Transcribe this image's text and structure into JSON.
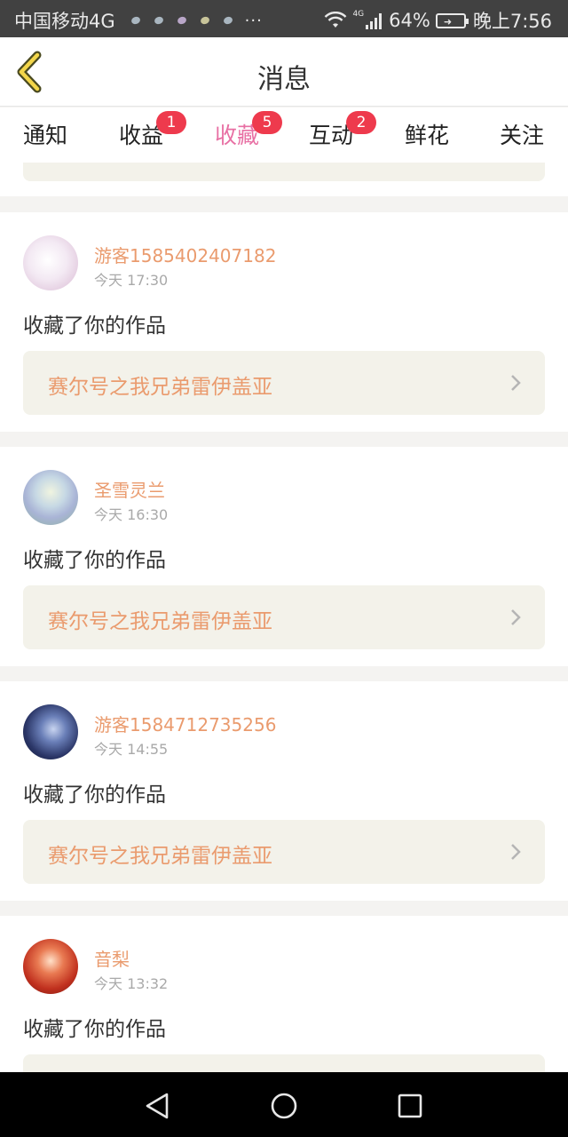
{
  "status_bar": {
    "carrier": "中国移动4G",
    "more": "···",
    "network": "4G",
    "battery": "64%",
    "time": "晚上7:56"
  },
  "nav": {
    "title": "消息"
  },
  "tabs": [
    {
      "label": "通知",
      "badge": null,
      "active": false
    },
    {
      "label": "收益",
      "badge": "1",
      "active": false
    },
    {
      "label": "收藏",
      "badge": "5",
      "active": true
    },
    {
      "label": "互动",
      "badge": "2",
      "active": false
    },
    {
      "label": "鲜花",
      "badge": null,
      "active": false
    },
    {
      "label": "关注",
      "badge": null,
      "active": false
    }
  ],
  "notifications": [
    {
      "user": "游客1585402407182",
      "time": "今天 17:30",
      "action": "收藏了你的作品",
      "work": "赛尔号之我兄弟雷伊盖亚",
      "avatar_color": "#f1e6f2"
    },
    {
      "user": "圣雪灵兰",
      "time": "今天 16:30",
      "action": "收藏了你的作品",
      "work": "赛尔号之我兄弟雷伊盖亚",
      "avatar_color": "#b8d4dc"
    },
    {
      "user": "游客1584712735256",
      "time": "今天 14:55",
      "action": "收藏了你的作品",
      "work": "赛尔号之我兄弟雷伊盖亚",
      "avatar_color": "#1f2a4d"
    },
    {
      "user": "音梨",
      "time": "今天 13:32",
      "action": "收藏了你的作品",
      "work": "",
      "avatar_color": "#c2402d"
    }
  ],
  "colors": {
    "accent_pink": "#e870a4",
    "badge_red": "#ee3a4d",
    "name_orange": "#ea9b6e",
    "work_bg": "#f3f2ea"
  }
}
